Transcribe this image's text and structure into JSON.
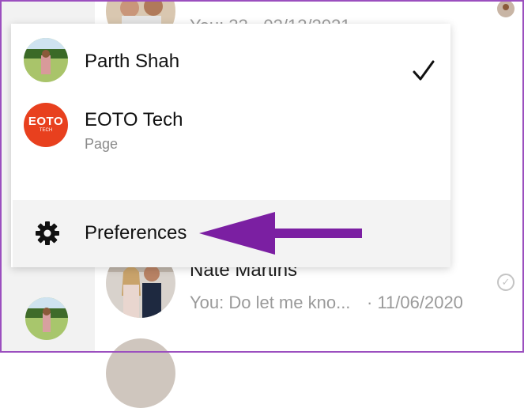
{
  "background": {
    "top_preview": "You: 33 · 02/12/2021",
    "contact_name": "Nate Martins",
    "contact_preview": "You: Do let me kno...",
    "contact_date": "· 11/06/2020"
  },
  "menu": {
    "accounts": [
      {
        "name": "Parth Shah",
        "subtitle": "",
        "selected": true
      },
      {
        "name": "EOTO Tech",
        "subtitle": "Page",
        "selected": false,
        "logo_text": "EOTO",
        "logo_subtext": "TECH"
      }
    ],
    "preferences_label": "Preferences"
  },
  "colors": {
    "arrow": "#7b1fa2",
    "eoto_brand": "#e8401e",
    "frame": "#9b4fbf"
  }
}
